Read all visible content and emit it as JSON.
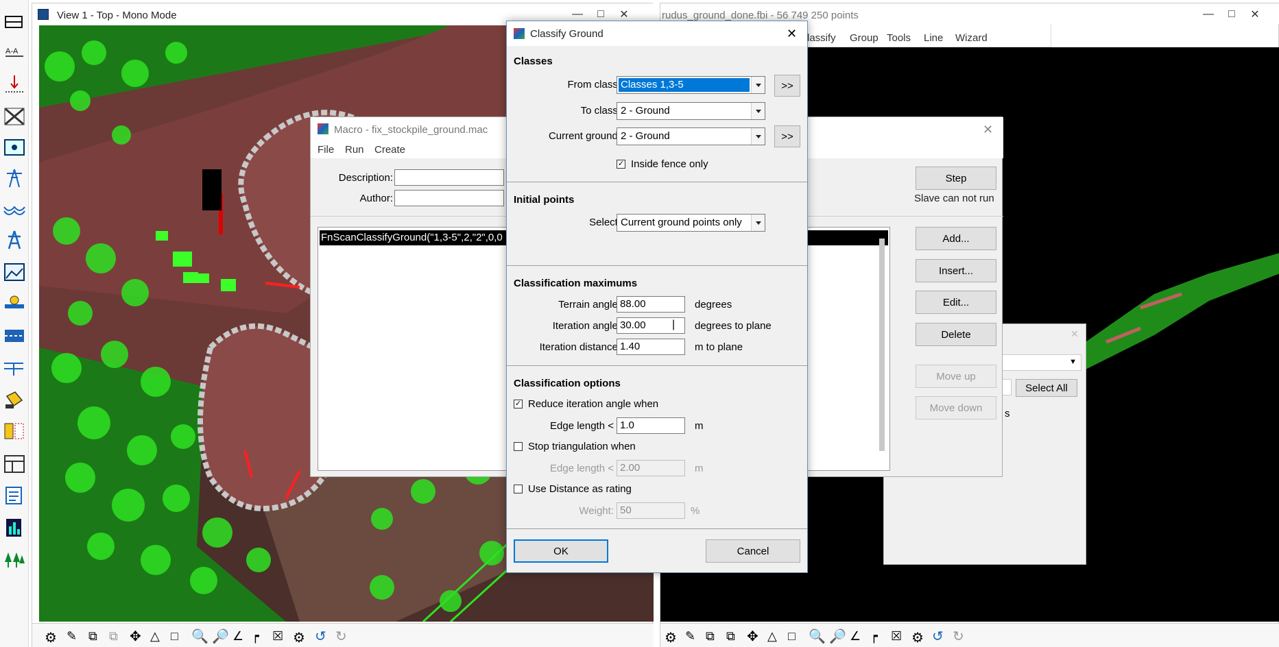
{
  "view1": {
    "title": "View 1 - Top - Mono Mode"
  },
  "view2": {
    "title": "rudus_ground_done.fbi - 56 749 250 points",
    "menu": [
      "lassify",
      "Group",
      "Tools",
      "Line",
      "Wizard"
    ]
  },
  "macro": {
    "title": "Macro - fix_stockpile_ground.mac",
    "menu": [
      "File",
      "Run",
      "Create"
    ],
    "description_label": "Description:",
    "author_label": "Author:",
    "description_value": "",
    "author_value": "",
    "code_line": "FnScanClassifyGround(\"1,3-5\",2,\"2\",0,0",
    "buttons": {
      "step": "Step",
      "slave_status": "Slave can not run",
      "add": "Add...",
      "insert": "Insert...",
      "edit": "Edit...",
      "delete": "Delete",
      "move_up": "Move up",
      "move_down": "Move down"
    }
  },
  "bg_dialog": {
    "select_all": "Select All",
    "partial_text": "s"
  },
  "dialog": {
    "title": "Classify Ground",
    "sections": {
      "classes": "Classes",
      "initial_points": "Initial points",
      "maximums": "Classification maximums",
      "options": "Classification options"
    },
    "from_class": {
      "label": "From class:",
      "value": "Classes 1,3-5"
    },
    "to_class": {
      "label": "To class:",
      "value": "2 - Ground"
    },
    "current_ground": {
      "label": "Current ground:",
      "value": "2 - Ground"
    },
    "expand_label": ">>",
    "inside_fence": {
      "label": "Inside fence only",
      "checked": true,
      "mark": "✓"
    },
    "select": {
      "label": "Select:",
      "value": "Current ground points only"
    },
    "terrain_angle": {
      "label": "Terrain angle:",
      "value": "88.00",
      "unit": "degrees"
    },
    "iteration_angle": {
      "label": "Iteration angle:",
      "value": "30.00",
      "unit": "degrees to plane"
    },
    "iteration_distance": {
      "label": "Iteration distance:",
      "value": "1.40",
      "unit": "m to plane"
    },
    "reduce_angle": {
      "label": "Reduce iteration angle when",
      "checked": true
    },
    "edge_length_1": {
      "label": "Edge length <",
      "value": "1.0",
      "unit": "m"
    },
    "stop_triangulation": {
      "label": "Stop triangulation when",
      "checked": false
    },
    "edge_length_2": {
      "label": "Edge length <",
      "value": "2.00",
      "unit": "m"
    },
    "use_distance": {
      "label": "Use Distance as rating",
      "checked": false
    },
    "weight": {
      "label": "Weight:",
      "value": "50",
      "unit": "%"
    },
    "ok": "OK",
    "cancel": "Cancel"
  },
  "colors": {
    "accent": "#0078d7",
    "vegetation": "#22c61a",
    "ground": "#7a3f3c",
    "background": "#000000"
  }
}
